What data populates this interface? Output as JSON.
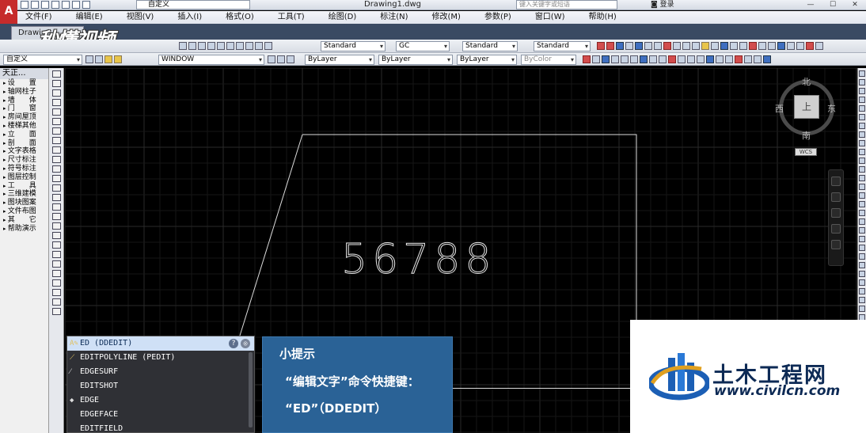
{
  "titlebar": {
    "workspace": "自定义",
    "doc_title": "Drawing1.dwg",
    "search_placeholder": "键入关键字或短语",
    "login": "登录",
    "help_icon": "question-icon"
  },
  "menubar": [
    "文件(F)",
    "编辑(E)",
    "视图(V)",
    "插入(I)",
    "格式(O)",
    "工具(T)",
    "绘图(D)",
    "标注(N)",
    "修改(M)",
    "参数(P)",
    "窗口(W)",
    "帮助(H)"
  ],
  "tab": {
    "label": "Drawi"
  },
  "watermark_top": "秒懂视频",
  "toolbar1": {
    "text_style": "Standard",
    "dim_style": "GC",
    "table_style": "Standard",
    "mleader_style": "Standard"
  },
  "toolbar2": {
    "workspace": "自定义",
    "layer": "WINDOW",
    "color": "ByLayer",
    "linetype": "ByLayer",
    "lineweight": "ByLayer",
    "plotstyle": "ByColor"
  },
  "tz_panel": {
    "title": "天正...",
    "items": [
      "设　　置",
      "轴网柱子",
      "墙　　体",
      "门　　窗",
      "房间屋顶",
      "楼梯其他",
      "立　　面",
      "剖　　面",
      "文字表格",
      "尺寸标注",
      "符号标注",
      "图层控制",
      "工　　具",
      "三维建模",
      "图块图案",
      "文件布图",
      "其　　它",
      "帮助演示"
    ]
  },
  "drawing": {
    "text": "56788"
  },
  "viewcube": {
    "north": "北",
    "south": "南",
    "west": "西",
    "east": "东",
    "face": "上",
    "wcs": "WCS"
  },
  "autocomplete": {
    "items": [
      {
        "label": "ED (DDEDIT)",
        "icon": "edit-text-icon",
        "selected": true
      },
      {
        "label": "EDITPOLYLINE (PEDIT)",
        "icon": "edit-polyline-icon",
        "selected": false
      },
      {
        "label": "EDGESURF",
        "icon": "edge-surface-icon",
        "selected": false
      },
      {
        "label": "EDITSHOT",
        "icon": "",
        "selected": false
      },
      {
        "label": "EDGE",
        "icon": "edge-icon",
        "selected": false
      },
      {
        "label": "EDGEFACE",
        "icon": "",
        "selected": false
      },
      {
        "label": "EDITFIELD",
        "icon": "",
        "selected": false
      }
    ]
  },
  "tip": {
    "title": "小提示",
    "line1": "“编辑文字”命令快捷键：",
    "line2": "“ED”（DDEDIT）"
  },
  "civil_logo": {
    "name": "土木工程网",
    "url": "www.civilcn.com"
  },
  "colors": {
    "canvas": "#000000",
    "tip_bg": "#2a6296",
    "dropdown_bg": "#2f3035",
    "selected_bg": "#cfe0f6",
    "logo_text": "#0d2a55"
  }
}
